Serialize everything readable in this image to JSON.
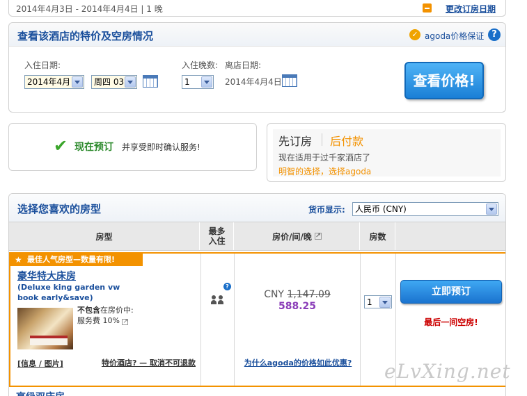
{
  "top_strip": {
    "date_range": "2014年4月3日 - 2014年4月4日 | 1 晚",
    "change_link": "更改订房日期"
  },
  "availability": {
    "title": "查看该酒店的特价及空房情况",
    "guarantee": "agoda价格保证",
    "checkin_label": "入住日期:",
    "checkin_month": "2014年4月",
    "checkin_day": "周四 03",
    "nights_label": "入住晚数:",
    "nights_value": "1",
    "checkout_label": "离店日期:",
    "checkout_value": "2014年4月4日",
    "check_price_button": "查看价格!"
  },
  "promo": {
    "book_now_label": "现在预订",
    "book_now_desc": "并享受即时确认服务!",
    "pay_later_a": "先订房",
    "pay_later_b": "后付款",
    "pay_later_line1": "现在适用于过千家酒店了",
    "pay_later_line2": "明智的选择，选择agoda"
  },
  "rooms": {
    "title": "选择您喜欢的房型",
    "currency_label": "货币显示:",
    "currency_value": "人民币 (CNY)",
    "columns": {
      "room_type": "房型",
      "max_occupancy": "最多\n入住",
      "price_per_night": "房价/间/晚",
      "room_count": "房数"
    },
    "row": {
      "popular_tag": "最佳人气房型—数量有限!",
      "name": "豪华特大床房",
      "subtitle": "(Deluxe king garden vw book early&save)",
      "not_included_1": "不包含在房价中:",
      "not_included_bold": "不包含",
      "not_included_rest": "在房价中:",
      "service_fee": "服务费 10%",
      "info_link": "[信息 / 图片]",
      "special_link": "特价酒店? — 取消不可退款",
      "currency": "CNY",
      "old_price": "1,147.09",
      "new_price": "588.25",
      "why_link": "为什么agoda的价格如此优惠?",
      "qty": "1",
      "book_button": "立即预订",
      "last_room": "最后一间空房!"
    },
    "next_row_name": "高级双床房"
  },
  "watermark": "eLvXing.net"
}
